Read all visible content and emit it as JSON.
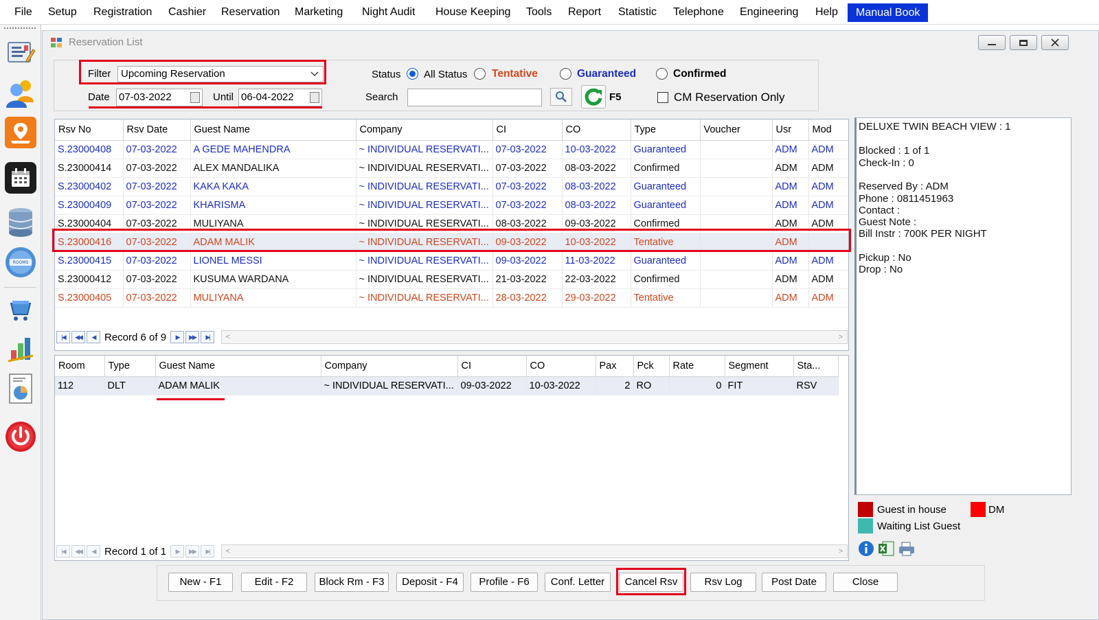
{
  "menu": {
    "items": [
      "File",
      "Setup",
      "Registration",
      "Cashier",
      "Reservation",
      "Marketing",
      "Night Audit",
      "House Keeping",
      "Tools",
      "Report",
      "Statistic",
      "Telephone",
      "Engineering",
      "Help"
    ],
    "highlight_label": "Manual Book",
    "highlight_color": "#0b34d8"
  },
  "left_toolbar": {
    "icons": [
      "front-desk-icon",
      "guests-icon",
      "map-location-icon",
      "calendar-icon",
      "server-icon",
      "rooms-available-icon",
      "shopping-cart-icon",
      "bar-chart-icon",
      "pie-report-icon",
      "power-icon"
    ]
  },
  "window": {
    "title": "Reservation List"
  },
  "filter": {
    "label": "Filter",
    "value": "Upcoming Reservation",
    "date_label": "Date",
    "date_from": "07-03-2022",
    "until_label": "Until",
    "date_until": "06-04-2022",
    "status_label": "Status",
    "status_options": [
      {
        "label": "All Status",
        "checked": true,
        "color": "#111111"
      },
      {
        "label": "Tentative",
        "checked": false,
        "color": "#d4471c"
      },
      {
        "label": "Guaranteed",
        "checked": false,
        "color": "#1c2dc4"
      },
      {
        "label": "Confirmed",
        "checked": false,
        "color": "#111111"
      }
    ],
    "search_label": "Search",
    "search_value": "",
    "refresh_key": "F5",
    "cm_only_label": "CM Reservation Only",
    "cm_only_checked": false
  },
  "reservations": {
    "columns": [
      "Rsv No",
      "Rsv Date",
      "Guest Name",
      "Company",
      "CI",
      "CO",
      "Type",
      "Voucher",
      "Usr",
      "Mod"
    ],
    "rows": [
      {
        "rsv_no": "S.23000408",
        "rsv_date": "07-03-2022",
        "guest": "A GEDE MAHENDRA",
        "company": "~ INDIVIDUAL RESERVATI...",
        "ci": "07-03-2022",
        "co": "10-03-2022",
        "type": "Guaranteed",
        "voucher": "",
        "usr": "ADM",
        "mod": "ADM",
        "tone": "blue",
        "selected": false
      },
      {
        "rsv_no": "S.23000414",
        "rsv_date": "07-03-2022",
        "guest": "ALEX MANDALIKA",
        "company": "~ INDIVIDUAL RESERVATI...",
        "ci": "07-03-2022",
        "co": "08-03-2022",
        "type": "Confirmed",
        "voucher": "",
        "usr": "ADM",
        "mod": "ADM",
        "tone": "black",
        "selected": false
      },
      {
        "rsv_no": "S.23000402",
        "rsv_date": "07-03-2022",
        "guest": "KAKA KAKA",
        "company": "~ INDIVIDUAL RESERVATI...",
        "ci": "07-03-2022",
        "co": "08-03-2022",
        "type": "Guaranteed",
        "voucher": "",
        "usr": "ADM",
        "mod": "ADM",
        "tone": "blue",
        "selected": false
      },
      {
        "rsv_no": "S.23000409",
        "rsv_date": "07-03-2022",
        "guest": "KHARISMA",
        "company": "~ INDIVIDUAL RESERVATI...",
        "ci": "07-03-2022",
        "co": "08-03-2022",
        "type": "Guaranteed",
        "voucher": "",
        "usr": "ADM",
        "mod": "ADM",
        "tone": "blue",
        "selected": false
      },
      {
        "rsv_no": "S.23000404",
        "rsv_date": "07-03-2022",
        "guest": "MULIYANA",
        "company": "~ INDIVIDUAL RESERVATI...",
        "ci": "08-03-2022",
        "co": "09-03-2022",
        "type": "Confirmed",
        "voucher": "",
        "usr": "ADM",
        "mod": "ADM",
        "tone": "black",
        "selected": false
      },
      {
        "rsv_no": "S.23000416",
        "rsv_date": "07-03-2022",
        "guest": "ADAM MALIK",
        "company": "~ INDIVIDUAL RESERVATI...",
        "ci": "09-03-2022",
        "co": "10-03-2022",
        "type": "Tentative",
        "voucher": "",
        "usr": "ADM",
        "mod": "",
        "tone": "red",
        "selected": true
      },
      {
        "rsv_no": "S.23000415",
        "rsv_date": "07-03-2022",
        "guest": "LIONEL MESSI",
        "company": "~ INDIVIDUAL RESERVATI...",
        "ci": "09-03-2022",
        "co": "11-03-2022",
        "type": "Guaranteed",
        "voucher": "",
        "usr": "ADM",
        "mod": "ADM",
        "tone": "blue",
        "selected": false
      },
      {
        "rsv_no": "S.23000412",
        "rsv_date": "07-03-2022",
        "guest": "KUSUMA WARDANA",
        "company": "~ INDIVIDUAL RESERVATI...",
        "ci": "21-03-2022",
        "co": "22-03-2022",
        "type": "Confirmed",
        "voucher": "",
        "usr": "ADM",
        "mod": "ADM",
        "tone": "black",
        "selected": false
      },
      {
        "rsv_no": "S.23000405",
        "rsv_date": "07-03-2022",
        "guest": "MULIYANA",
        "company": "~ INDIVIDUAL RESERVATI...",
        "ci": "28-03-2022",
        "co": "29-03-2022",
        "type": "Tentative",
        "voucher": "",
        "usr": "ADM",
        "mod": "ADM",
        "tone": "red",
        "selected": false
      }
    ],
    "record_text": "Record 6 of 9"
  },
  "rooms": {
    "columns": [
      "Room",
      "Type",
      "Guest Name",
      "Company",
      "CI",
      "CO",
      "Pax",
      "Pck",
      "Rate",
      "Segment",
      "Sta..."
    ],
    "rows": [
      {
        "room": "112",
        "type": "DLT",
        "guest": "ADAM MALIK",
        "company": "~ INDIVIDUAL RESERVATI...",
        "ci": "09-03-2022",
        "co": "10-03-2022",
        "pax": "2",
        "pck": "RO",
        "rate": "0",
        "segment": "FIT",
        "status": "RSV"
      }
    ],
    "record_text": "Record 1 of 1"
  },
  "info": {
    "lines": [
      "DELUXE TWIN BEACH VIEW : 1",
      "Blocked : 1 of 1",
      "Check-In : 0",
      "Reserved By : ADM",
      "Phone : 0811451963",
      "Contact :",
      "Guest Note :",
      "Bill Instr : 700K PER NIGHT",
      "Pickup : No",
      "Drop : No"
    ]
  },
  "legend": {
    "items": [
      {
        "label": "Guest in house",
        "color": "#c00000"
      },
      {
        "label": "DM",
        "color": "#ff0000"
      },
      {
        "label": "Waiting List Guest",
        "color": "#3fb8b0"
      }
    ]
  },
  "buttons": [
    "New - F1",
    "Edit - F2",
    "Block Rm - F3",
    "Deposit - F4",
    "Profile  - F6",
    "Conf. Letter",
    "Cancel Rsv",
    "Rsv Log",
    "Post Date",
    "Close"
  ]
}
